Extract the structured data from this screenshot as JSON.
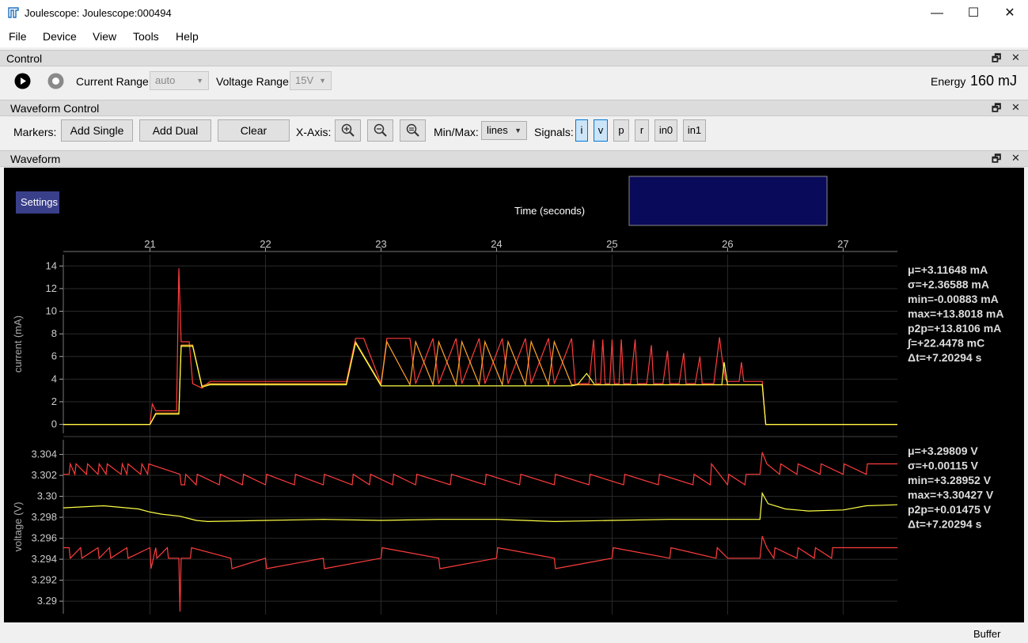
{
  "window": {
    "title": "Joulescope: Joulescope:000494",
    "minimize": "—",
    "maximize": "☐",
    "close": "✕"
  },
  "menu": [
    "File",
    "Device",
    "View",
    "Tools",
    "Help"
  ],
  "control_panel": {
    "title": "Control",
    "current_range_label": "Current Range",
    "current_range_value": "auto",
    "voltage_range_label": "Voltage Range",
    "voltage_range_value": "15V",
    "energy_label": "Energy",
    "energy_value": "160 mJ"
  },
  "waveform_control": {
    "title": "Waveform Control",
    "markers_label": "Markers:",
    "add_single": "Add Single",
    "add_dual": "Add Dual",
    "clear": "Clear",
    "xaxis_label": "X-Axis:",
    "minmax_label": "Min/Max:",
    "minmax_value": "lines",
    "signals_label": "Signals:",
    "signals": [
      {
        "label": "i",
        "active": true
      },
      {
        "label": "v",
        "active": true
      },
      {
        "label": "p",
        "active": false
      },
      {
        "label": "r",
        "active": false
      },
      {
        "label": "in0",
        "active": false
      },
      {
        "label": "in1",
        "active": false
      }
    ]
  },
  "waveform_panel": {
    "title": "Waveform",
    "settings_label": "Settings",
    "time_label": "Time (seconds)"
  },
  "status": {
    "buffer": "Buffer"
  },
  "chart_data": [
    {
      "type": "line",
      "title": "",
      "xlabel": "Time (seconds)",
      "ylabel": "current (mA)",
      "xticks": [
        "21",
        "22",
        "23",
        "24",
        "25",
        "26",
        "27"
      ],
      "xlim": [
        20.25,
        27.47
      ],
      "yticks": [
        "0",
        "2",
        "4",
        "6",
        "8",
        "10",
        "12",
        "14"
      ],
      "ylim": [
        -0.8,
        15
      ],
      "grid": true,
      "series": [
        {
          "color": "#ff3c3c",
          "x": [
            20.25,
            21.0,
            21.02,
            21.05,
            21.23,
            21.25,
            21.27,
            21.3,
            21.34,
            21.37,
            21.45,
            21.52,
            22.0,
            22.7,
            22.78,
            22.85,
            23.0,
            23.05,
            23.25,
            23.3,
            23.45,
            23.5,
            23.65,
            23.7,
            23.85,
            23.9,
            24.05,
            24.1,
            24.25,
            24.3,
            24.45,
            24.5,
            24.65,
            24.68,
            24.75,
            24.8,
            24.84,
            24.86,
            24.9,
            24.92,
            24.94,
            24.98,
            25.0,
            25.02,
            25.06,
            25.08,
            25.1,
            25.16,
            25.2,
            25.22,
            25.3,
            25.34,
            25.36,
            25.44,
            25.48,
            25.5,
            25.58,
            25.62,
            25.64,
            25.72,
            25.76,
            25.78,
            25.88,
            25.93,
            25.95,
            25.98,
            26.0,
            26.1,
            26.12,
            26.14,
            26.25,
            26.3,
            26.33,
            27.47
          ],
          "y": [
            0.0,
            0.0,
            1.8,
            1.2,
            1.2,
            13.8,
            7.3,
            7.3,
            7.3,
            3.6,
            3.2,
            3.8,
            3.8,
            3.8,
            7.6,
            7.6,
            3.6,
            7.6,
            7.6,
            3.6,
            7.6,
            3.6,
            7.6,
            3.6,
            7.6,
            3.6,
            7.6,
            3.6,
            7.6,
            3.6,
            7.6,
            3.6,
            7.6,
            3.6,
            3.6,
            3.6,
            7.5,
            3.6,
            3.6,
            7.5,
            3.6,
            3.6,
            7.5,
            3.6,
            3.6,
            7.5,
            3.6,
            3.6,
            7.5,
            3.6,
            3.6,
            7.0,
            3.6,
            3.6,
            6.5,
            3.6,
            3.6,
            6.3,
            3.6,
            3.6,
            6.0,
            3.6,
            3.6,
            7.7,
            6.0,
            4.0,
            3.8,
            3.8,
            5.5,
            3.8,
            3.8,
            3.8,
            0.0,
            0.0
          ]
        },
        {
          "color": "#ffa42a",
          "x": [
            20.25,
            21.0,
            21.05,
            21.25,
            21.27,
            21.37,
            21.45,
            21.52,
            22.7,
            22.78,
            23.0,
            23.05,
            23.25,
            23.3,
            23.45,
            23.5,
            23.65,
            23.7,
            23.85,
            23.9,
            24.05,
            24.1,
            24.25,
            24.3,
            24.45,
            24.5,
            24.65,
            24.68,
            25.95,
            26.0,
            26.3,
            26.33,
            27.47
          ],
          "y": [
            0.0,
            0.0,
            1.0,
            1.0,
            7.0,
            7.0,
            3.4,
            3.6,
            3.6,
            7.3,
            3.5,
            7.3,
            3.5,
            7.3,
            3.5,
            7.3,
            3.5,
            7.3,
            3.5,
            7.3,
            3.5,
            7.3,
            3.5,
            7.3,
            3.5,
            7.3,
            3.5,
            3.5,
            3.5,
            3.5,
            3.5,
            0.0,
            0.0
          ]
        },
        {
          "color": "#ffff44",
          "x": [
            20.25,
            21.0,
            21.05,
            21.25,
            21.27,
            21.37,
            21.45,
            21.52,
            22.7,
            22.78,
            23.0,
            24.65,
            24.7,
            24.78,
            24.85,
            25.95,
            25.97,
            26.0,
            26.3,
            26.33,
            27.47
          ],
          "y": [
            0.0,
            0.0,
            0.9,
            0.9,
            6.9,
            6.9,
            3.3,
            3.5,
            3.5,
            7.2,
            3.4,
            3.4,
            3.5,
            4.5,
            3.5,
            3.5,
            5.5,
            3.5,
            3.5,
            0.0,
            0.0
          ]
        }
      ],
      "stats": [
        "μ=+3.11648 mA",
        "σ=+2.36588 mA",
        "min=-0.00883 mA",
        "max=+13.8018 mA",
        "p2p=+13.8106 mA",
        "∫=+22.4478 mC",
        "Δt=+7.20294 s"
      ]
    },
    {
      "type": "line",
      "title": "",
      "xlabel": "",
      "ylabel": "voltage (V)",
      "yticks": [
        "3.29",
        "3.292",
        "3.294",
        "3.296",
        "3.298",
        "3.30",
        "3.302",
        "3.304"
      ],
      "ylim": [
        3.2888,
        3.3054
      ],
      "grid": true,
      "series": [
        {
          "color": "#ff3c3c",
          "x": [
            20.25,
            20.3,
            20.31,
            20.35,
            20.36,
            20.45,
            20.46,
            20.55,
            20.56,
            20.62,
            20.63,
            20.75,
            20.76,
            20.8,
            20.81,
            20.92,
            20.93,
            20.98,
            20.99,
            21.26,
            21.27,
            21.3,
            21.31,
            21.4,
            21.41,
            21.6,
            21.61,
            21.8,
            21.81,
            22.0,
            22.01,
            22.25,
            22.26,
            22.5,
            22.51,
            22.75,
            22.76,
            22.9,
            22.91,
            23.1,
            23.11,
            23.3,
            23.31,
            23.6,
            23.61,
            23.9,
            23.91,
            24.2,
            24.21,
            24.5,
            24.51,
            24.8,
            24.81,
            25.1,
            25.11,
            25.4,
            25.41,
            25.7,
            25.71,
            25.85,
            25.86,
            26.0,
            26.01,
            26.15,
            26.16,
            26.28,
            26.3,
            26.34,
            26.45,
            26.46,
            26.6,
            26.61,
            26.8,
            26.81,
            27.0,
            27.01,
            27.2,
            27.21,
            27.47
          ],
          "y": [
            3.3021,
            3.3021,
            3.3031,
            3.3021,
            3.3031,
            3.3021,
            3.3031,
            3.3021,
            3.3031,
            3.3021,
            3.3031,
            3.3021,
            3.3031,
            3.3021,
            3.3031,
            3.3021,
            3.3031,
            3.3021,
            3.3031,
            3.3021,
            3.3011,
            3.3011,
            3.3021,
            3.3011,
            3.3021,
            3.3011,
            3.3021,
            3.3011,
            3.3021,
            3.3011,
            3.3021,
            3.3011,
            3.3021,
            3.3011,
            3.3021,
            3.3011,
            3.3021,
            3.3011,
            3.3021,
            3.3011,
            3.3021,
            3.3011,
            3.3021,
            3.3011,
            3.3021,
            3.3011,
            3.3021,
            3.3011,
            3.3021,
            3.3011,
            3.3021,
            3.3011,
            3.3021,
            3.3011,
            3.3021,
            3.3011,
            3.3021,
            3.3011,
            3.3021,
            3.3011,
            3.3031,
            3.3011,
            3.3021,
            3.3011,
            3.3021,
            3.3021,
            3.3042,
            3.3031,
            3.3021,
            3.3031,
            3.3021,
            3.3031,
            3.3021,
            3.3031,
            3.3021,
            3.3031,
            3.3021,
            3.3031,
            3.3031
          ]
        },
        {
          "color": "#ffff44",
          "x": [
            20.25,
            20.6,
            20.9,
            21.0,
            21.1,
            21.26,
            21.4,
            21.5,
            22.0,
            22.5,
            23.0,
            23.5,
            24.0,
            24.5,
            25.0,
            25.5,
            26.0,
            26.28,
            26.3,
            26.35,
            26.5,
            26.7,
            27.0,
            27.2,
            27.47
          ],
          "y": [
            3.2989,
            3.2991,
            3.2988,
            3.2985,
            3.2983,
            3.2981,
            3.2977,
            3.2976,
            3.2977,
            3.2978,
            3.2977,
            3.2978,
            3.2978,
            3.2976,
            3.2977,
            3.2978,
            3.2978,
            3.2978,
            3.3003,
            3.2993,
            3.2988,
            3.2986,
            3.2987,
            3.2991,
            3.2992
          ]
        },
        {
          "color": "#ff3c3c",
          "x": [
            20.25,
            20.3,
            20.31,
            20.4,
            20.41,
            20.55,
            20.56,
            20.65,
            20.66,
            20.8,
            20.81,
            21.0,
            21.01,
            21.05,
            21.06,
            21.15,
            21.16,
            21.25,
            21.26,
            21.27,
            21.35,
            21.36,
            21.7,
            21.71,
            22.0,
            22.01,
            22.5,
            22.51,
            23.0,
            23.01,
            23.5,
            23.51,
            24.0,
            24.01,
            24.5,
            24.51,
            25.0,
            25.01,
            25.5,
            25.51,
            25.9,
            25.91,
            26.0,
            26.01,
            26.28,
            26.3,
            26.34,
            26.4,
            26.41,
            26.6,
            26.61,
            26.75,
            26.76,
            26.9,
            26.91,
            27.47
          ],
          "y": [
            3.2951,
            3.2951,
            3.2941,
            3.2951,
            3.2941,
            3.2951,
            3.2941,
            3.2951,
            3.2941,
            3.2951,
            3.2941,
            3.2951,
            3.2931,
            3.2951,
            3.2941,
            3.2951,
            3.2941,
            3.2941,
            3.289,
            3.2941,
            3.2941,
            3.2951,
            3.2941,
            3.2931,
            3.2941,
            3.2931,
            3.2941,
            3.2931,
            3.2941,
            3.2951,
            3.2941,
            3.2931,
            3.2941,
            3.2951,
            3.2941,
            3.2931,
            3.2941,
            3.2951,
            3.2941,
            3.2951,
            3.2941,
            3.2951,
            3.2941,
            3.2941,
            3.2941,
            3.2962,
            3.2951,
            3.2941,
            3.2951,
            3.2941,
            3.2951,
            3.2941,
            3.2951,
            3.2941,
            3.2951,
            3.2951
          ]
        }
      ],
      "stats": [
        "μ=+3.29809 V",
        "σ=+0.00115 V",
        "min=+3.28952 V",
        "max=+3.30427 V",
        "p2p=+0.01475 V",
        "Δt=+7.20294 s"
      ]
    }
  ]
}
